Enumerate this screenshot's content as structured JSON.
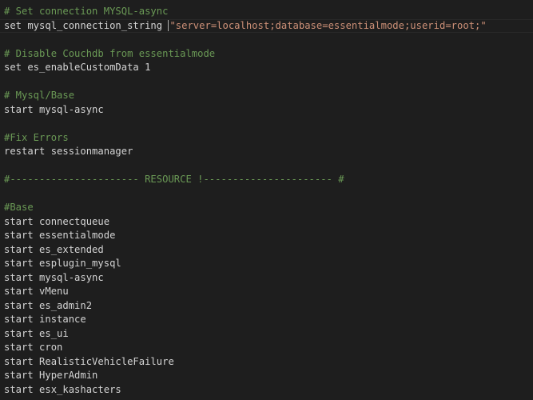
{
  "editor": {
    "lines": [
      {
        "type": "comment",
        "text": "# Set connection MYSQL-async"
      },
      {
        "type": "kv",
        "text": "set mysql_connection_string ",
        "value": "\"server=localhost;database=essentialmode;userid=root;\""
      },
      {
        "type": "empty",
        "text": ""
      },
      {
        "type": "comment",
        "text": "# Disable Couchdb from essentialmode"
      },
      {
        "type": "code",
        "text": "set es_enableCustomData 1"
      },
      {
        "type": "empty",
        "text": ""
      },
      {
        "type": "comment",
        "text": "# Mysql/Base"
      },
      {
        "type": "code",
        "text": "start mysql-async"
      },
      {
        "type": "empty",
        "text": ""
      },
      {
        "type": "comment",
        "text": "#Fix Errors"
      },
      {
        "type": "code",
        "text": "restart sessionmanager"
      },
      {
        "type": "empty",
        "text": ""
      },
      {
        "type": "comment",
        "text": "#---------------------- RESOURCE !---------------------- #"
      },
      {
        "type": "empty",
        "text": ""
      },
      {
        "type": "comment",
        "text": "#Base"
      },
      {
        "type": "code",
        "text": "start connectqueue"
      },
      {
        "type": "code",
        "text": "start essentialmode"
      },
      {
        "type": "code",
        "text": "start es_extended"
      },
      {
        "type": "code",
        "text": "start esplugin_mysql"
      },
      {
        "type": "code",
        "text": "start mysql-async"
      },
      {
        "type": "code",
        "text": "start vMenu"
      },
      {
        "type": "code",
        "text": "start es_admin2"
      },
      {
        "type": "code",
        "text": "start instance"
      },
      {
        "type": "code",
        "text": "start es_ui"
      },
      {
        "type": "code",
        "text": "start cron"
      },
      {
        "type": "code",
        "text": "start RealisticVehicleFailure"
      },
      {
        "type": "code",
        "text": "start HyperAdmin"
      },
      {
        "type": "code",
        "text": "start esx_kashacters"
      }
    ]
  },
  "colors": {
    "background": "#1e1e1e",
    "text": "#d4d4d4",
    "comment": "#6a9955",
    "string": "#ce9178"
  }
}
